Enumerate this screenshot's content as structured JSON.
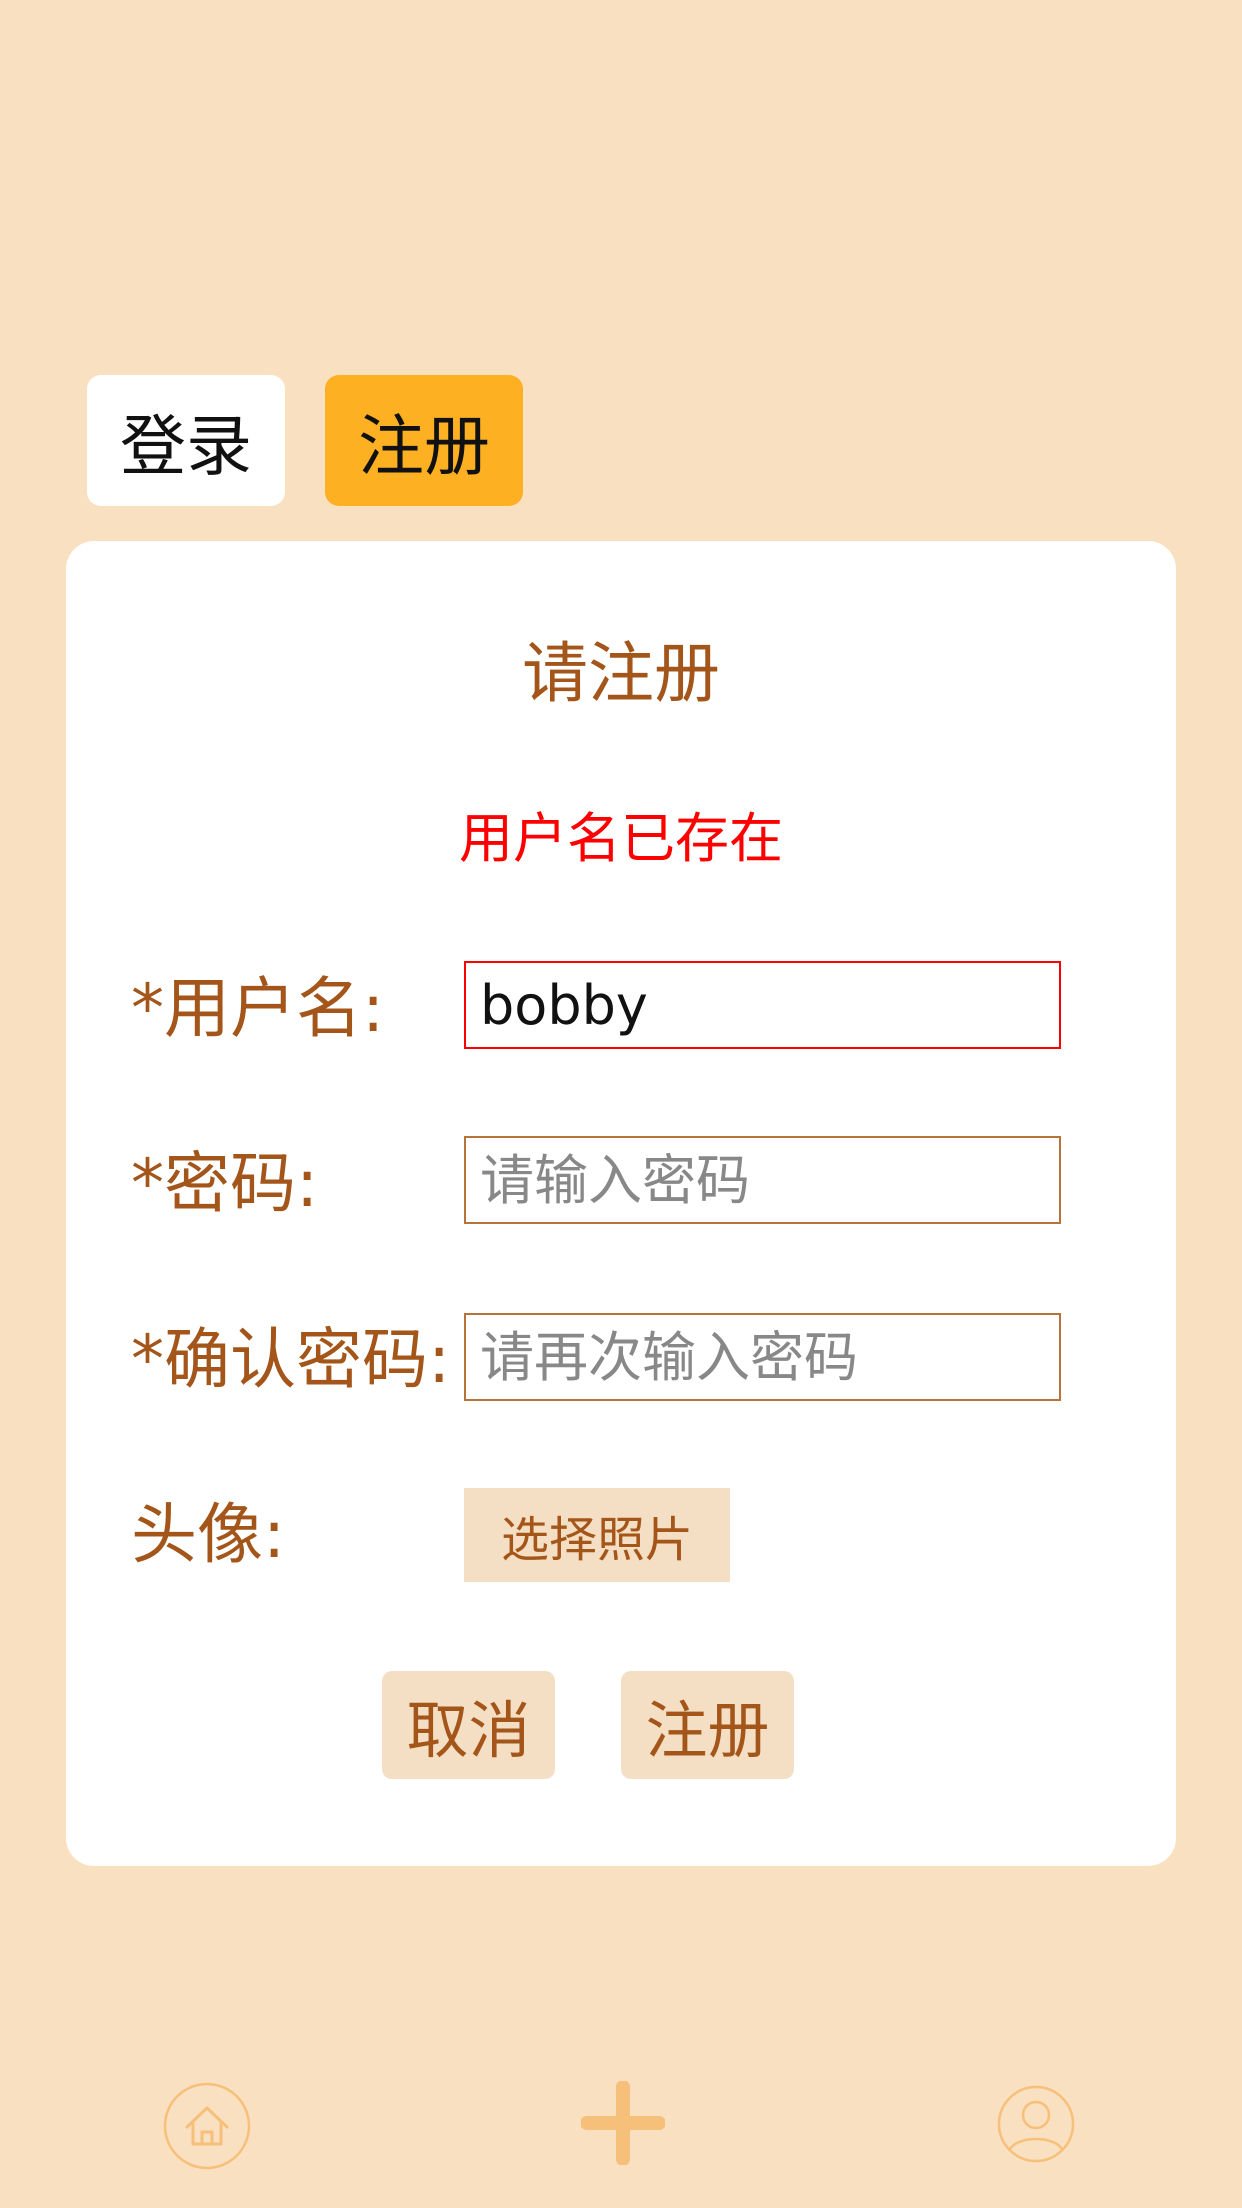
{
  "tabs": {
    "login_label": "登录",
    "register_label": "注册"
  },
  "form": {
    "title": "请注册",
    "error_message": "用户名已存在",
    "username": {
      "label": "*用户名:",
      "value": "bobby"
    },
    "password": {
      "label": "*密码:",
      "placeholder": "请输入密码"
    },
    "confirm_password": {
      "label": "*确认密码:",
      "placeholder": "请再次输入密码"
    },
    "avatar": {
      "label": "头像:",
      "button_label": "选择照片"
    },
    "cancel_label": "取消",
    "submit_label": "注册"
  },
  "bottom_nav": {
    "items": [
      {
        "icon": "home-icon"
      },
      {
        "icon": "plus-icon"
      },
      {
        "icon": "user-icon"
      }
    ]
  },
  "colors": {
    "background": "#f9e0c1",
    "accent": "#fdb022",
    "text_brown": "#a4561a",
    "error": "#ff0000",
    "button_bg": "#f5dfc4",
    "nav_icon": "#f7c07a"
  }
}
